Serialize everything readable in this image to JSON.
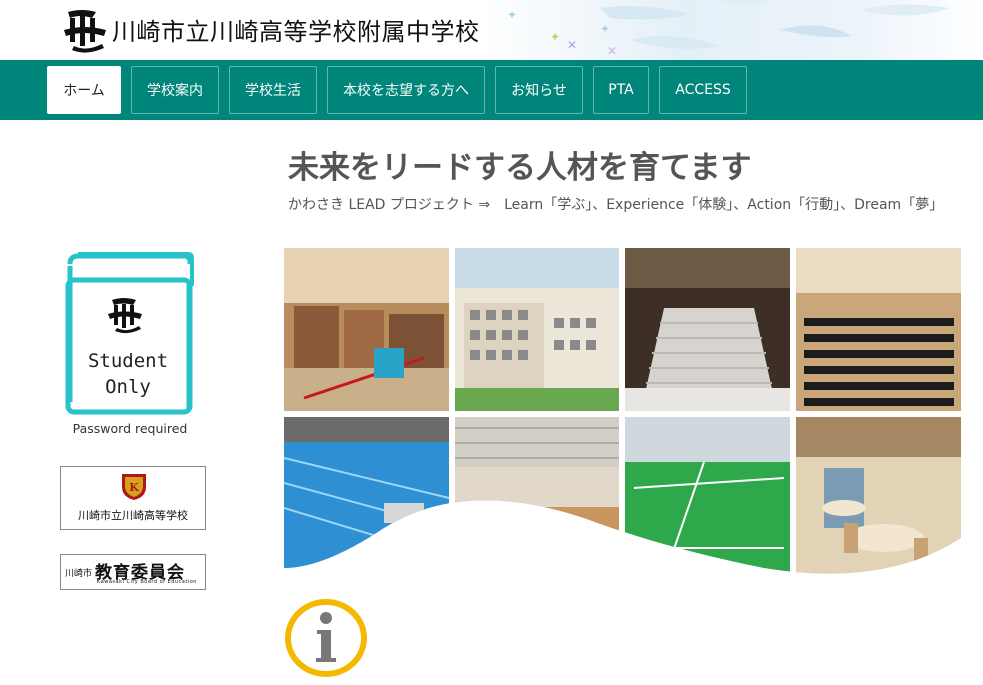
{
  "header": {
    "site_title": "川崎市立川崎高等学校附属中学校",
    "logo_icon": "school-emblem-icon"
  },
  "nav": {
    "items": [
      {
        "label": "ホーム",
        "active": true
      },
      {
        "label": "学校案内"
      },
      {
        "label": "学校生活"
      },
      {
        "label": "本校を志望する方へ"
      },
      {
        "label": "お知らせ"
      },
      {
        "label": "PTA"
      },
      {
        "label": "ACCESS"
      }
    ]
  },
  "main": {
    "heading": "未来をリードする人材を育てます",
    "subheading": "かわさき LEAD プロジェクト ⇒　Learn「学ぶ」、Experience「体験」、Action「行動」、Dream「夢」"
  },
  "sidebar": {
    "student_line1": "Student",
    "student_line2": "Only",
    "password_note": "Password required",
    "banner_highschool": "川崎市立川崎高等学校",
    "banner_board_small": "川崎市",
    "banner_board_big": "教育委員会",
    "banner_board_en": "Kawasaki City Board of Education"
  },
  "colors": {
    "nav_bg": "#00857a",
    "book_outline": "#27c3c9",
    "info_ring": "#f5b800"
  },
  "photos": [
    {
      "name": "library-photo"
    },
    {
      "name": "building-photo"
    },
    {
      "name": "staircase-photo"
    },
    {
      "name": "auditorium-photo"
    },
    {
      "name": "pool-photo"
    },
    {
      "name": "gymnasium-photo"
    },
    {
      "name": "rooftop-field-photo"
    },
    {
      "name": "cafeteria-photo"
    }
  ]
}
